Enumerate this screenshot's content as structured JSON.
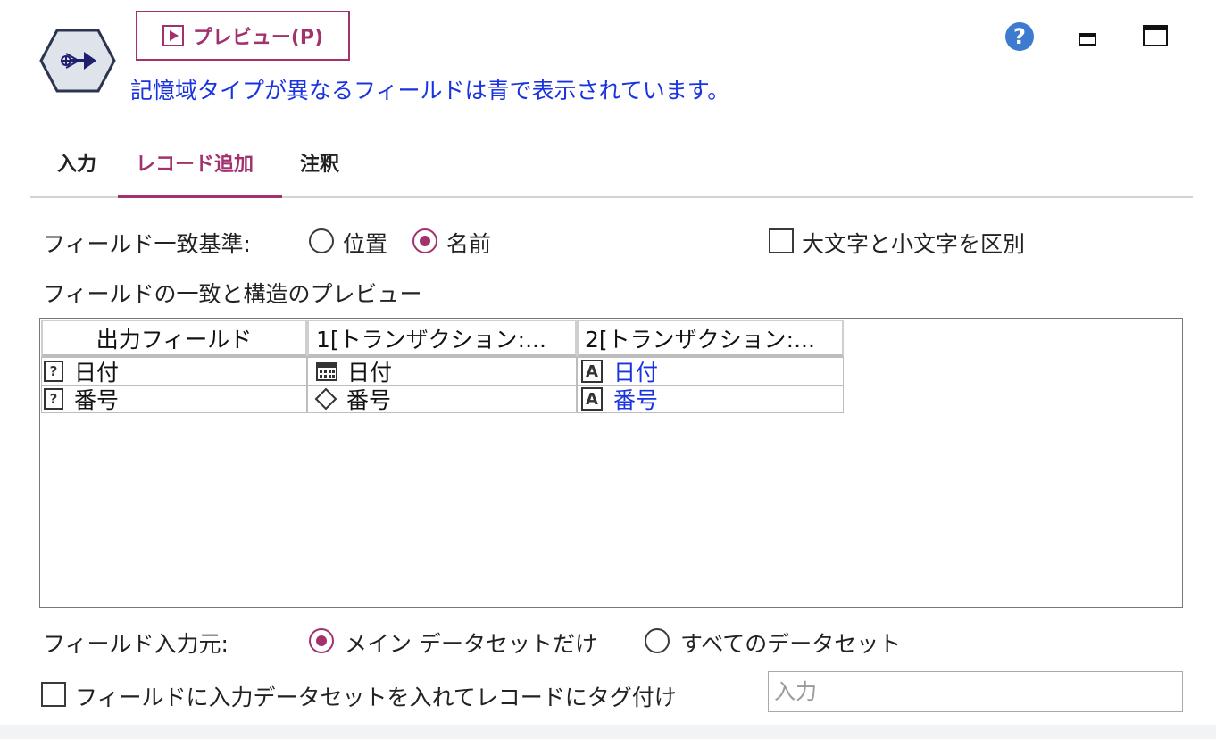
{
  "header": {
    "preview_button": "プレビュー(P)",
    "info_message": "記憶域タイプが異なるフィールドは青で表示されています。",
    "help_glyph": "?",
    "icons": [
      "append-node-icon",
      "play-icon",
      "help-icon",
      "minimize-icon",
      "maximize-icon"
    ]
  },
  "tabs": [
    {
      "label": "入力",
      "active": false
    },
    {
      "label": "レコード追加",
      "active": true
    },
    {
      "label": "注釈",
      "active": false
    }
  ],
  "match_by": {
    "label": "フィールド一致基準:",
    "options": [
      {
        "label": "位置",
        "selected": false
      },
      {
        "label": "名前",
        "selected": true
      }
    ],
    "case_sensitive": {
      "label": "大文字と小文字を区別",
      "checked": false
    }
  },
  "preview_section": {
    "label": "フィールドの一致と構造のプレビュー",
    "columns": [
      "出力フィールド",
      "1[トランザクション:...",
      "2[トランザクション:..."
    ],
    "rows": [
      {
        "output": {
          "icon": "unknown-type-icon",
          "icon_glyph": "?",
          "text": "日付"
        },
        "source1": {
          "icon": "calendar-icon",
          "text": "日付"
        },
        "source2": {
          "icon": "string-type-icon",
          "icon_glyph": "A",
          "text": "日付",
          "highlight": true
        }
      },
      {
        "output": {
          "icon": "unknown-type-icon",
          "icon_glyph": "?",
          "text": "番号"
        },
        "source1": {
          "icon": "diamond-icon",
          "text": "番号"
        },
        "source2": {
          "icon": "string-type-icon",
          "icon_glyph": "A",
          "text": "番号",
          "highlight": true
        }
      }
    ]
  },
  "field_source": {
    "label": "フィールド入力元:",
    "options": [
      {
        "label": "メイン データセットだけ",
        "selected": true
      },
      {
        "label": "すべてのデータセット",
        "selected": false
      }
    ]
  },
  "tag_records": {
    "label": "フィールドに入力データセットを入れてレコードにタグ付け",
    "checked": false,
    "input_placeholder": "入力",
    "input_value": ""
  },
  "colors": {
    "accent": "#a2326e",
    "info_blue": "#1a33e0",
    "help_blue": "#3d7bd0"
  }
}
